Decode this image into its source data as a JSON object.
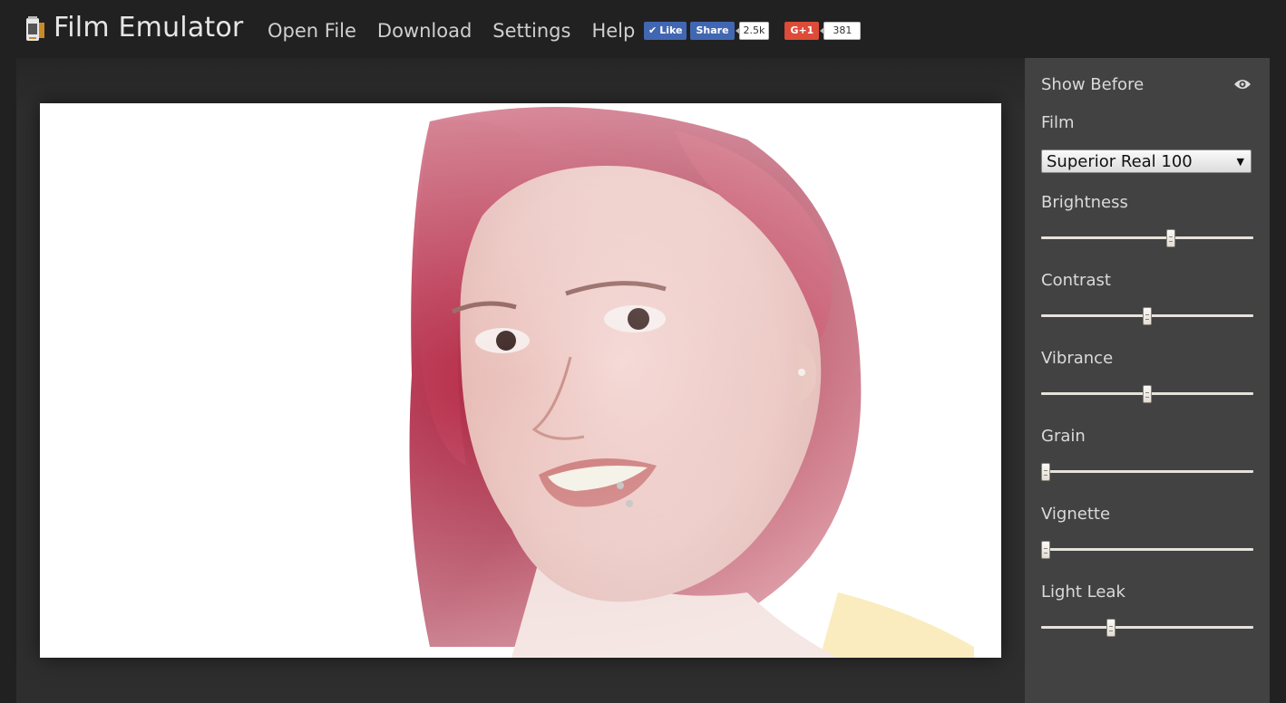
{
  "app": {
    "title": "Film Emulator",
    "logo_icon": "film-canister-icon"
  },
  "nav": {
    "items": [
      "Open File",
      "Download",
      "Settings",
      "Help"
    ]
  },
  "social": {
    "fb_like": "Like",
    "fb_share": "Share",
    "fb_count": "2.5k",
    "gplus": "G+1",
    "gplus_count": "381"
  },
  "sidebar": {
    "show_before": "Show Before",
    "show_before_icon": "eye-icon",
    "film_label": "Film",
    "film_value": "Superior Real 100",
    "sliders": [
      {
        "label": "Brightness",
        "value": 0.61
      },
      {
        "label": "Contrast",
        "value": 0.5
      },
      {
        "label": "Vibrance",
        "value": 0.5
      },
      {
        "label": "Grain",
        "value": 0.02
      },
      {
        "label": "Vignette",
        "value": 0.02
      },
      {
        "label": "Light Leak",
        "value": 0.33
      }
    ]
  },
  "colors": {
    "background": "#212121",
    "workspace": "#2e2e2e",
    "sidebar": "#424242",
    "facebook": "#4267b2",
    "google_plus": "#dd4b39"
  }
}
